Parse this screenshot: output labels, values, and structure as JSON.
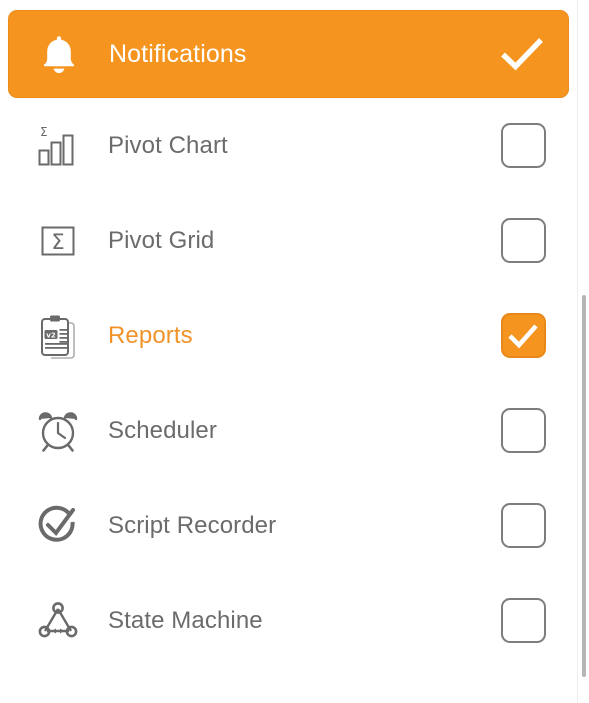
{
  "list": {
    "accent_color": "#f5941f",
    "text_color": "#6b6b6b",
    "rows": [
      {
        "label": "Notifications",
        "icon": "bell-icon",
        "checked": true,
        "selected": true,
        "control": "header-checkmark"
      },
      {
        "label": "Pivot Chart",
        "icon": "pivot-chart-icon",
        "checked": false,
        "selected": false,
        "control": "checkbox"
      },
      {
        "label": "Pivot Grid",
        "icon": "pivot-grid-icon",
        "checked": false,
        "selected": false,
        "control": "checkbox"
      },
      {
        "label": "Reports",
        "icon": "reports-clipboard-icon",
        "icon_badge": "v2",
        "checked": true,
        "selected": false,
        "control": "checkbox"
      },
      {
        "label": "Scheduler",
        "icon": "alarm-clock-icon",
        "checked": false,
        "selected": false,
        "control": "checkbox"
      },
      {
        "label": "Script Recorder",
        "icon": "check-circle-icon",
        "checked": false,
        "selected": false,
        "control": "checkbox"
      },
      {
        "label": "State Machine",
        "icon": "state-machine-nodes-icon",
        "checked": false,
        "selected": false,
        "control": "checkbox"
      }
    ]
  },
  "scrollbar": {
    "orientation": "vertical",
    "thumb_color": "#b6b6b6"
  }
}
